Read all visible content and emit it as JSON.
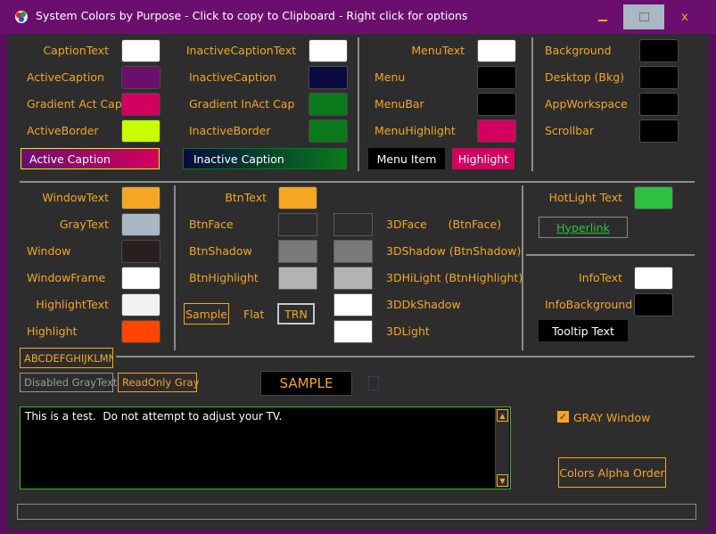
{
  "window": {
    "title": "System Colors by Purpose - Click to copy to Clipboard - Right click for options",
    "minimize": "_",
    "maximize": "□",
    "close": "x"
  },
  "caption_group": {
    "labels": [
      "CaptionText",
      "ActiveCaption",
      "Gradient Act Cap",
      "ActiveBorder"
    ],
    "colors": [
      "#ffffff",
      "#6b0f6e",
      "#d4005f",
      "#c8ff00"
    ],
    "sample": "Active Caption"
  },
  "inactive_group": {
    "labels": [
      "InactiveCaptionText",
      "InactiveCaption",
      "Gradient InAct Cap",
      "InactiveBorder"
    ],
    "colors": [
      "#ffffff",
      "#0a0a40",
      "#0a7a1a",
      "#0a7a1a"
    ],
    "sample": "Inactive Caption"
  },
  "menu_group": {
    "labels": [
      "MenuText",
      "Menu",
      "MenuBar",
      "MenuHighlight"
    ],
    "colors": [
      "#ffffff",
      "#000000",
      "#000000",
      "#d4005f"
    ],
    "menu_item": "Menu Item",
    "highlight": "Highlight"
  },
  "desktop_group": {
    "labels": [
      "Background",
      "Desktop (Bkg)",
      "AppWorkspace",
      "Scrollbar"
    ],
    "colors": [
      "#000000",
      "#000000",
      "#000000",
      "#000000"
    ]
  },
  "window_group": {
    "labels": [
      "WindowText",
      "GrayText",
      "Window",
      "WindowFrame",
      "HighlightText",
      "Highlight"
    ],
    "colors": [
      "#f5a623",
      "#a9b8c2",
      "#2a1f1f",
      "#ffffff",
      "#f2f2f2",
      "#ff4500"
    ]
  },
  "button_group": {
    "btntext_label": "BtnText",
    "btntext_color": "#f5a623",
    "left_labels": [
      "BtnFace",
      "BtnShadow",
      "BtnHighlight"
    ],
    "col1_colors": [
      "#2d2d2d",
      "#7a7a7a",
      "#b4b4b4"
    ],
    "col2_colors": [
      "#2d2d2d",
      "#7a7a7a",
      "#b4b4b4",
      "#ffffff",
      "#ffffff"
    ],
    "right_labels": [
      "3DFace      (BtnFace)",
      "3DShadow (BtnShadow)",
      "3DHiLight (BtnHighlight)",
      "3DDkShadow",
      "3DLight"
    ],
    "sample": "Sample",
    "flat": "Flat",
    "trn": "TRN"
  },
  "hotlight_group": {
    "hotlight_label": "HotLight Text",
    "hotlight_color": "#2ec040",
    "hyperlink": "Hyperlink",
    "infotext_label": "InfoText",
    "infotext_color": "#ffffff",
    "infobg_label": "InfoBackground",
    "infobg_color": "#000000",
    "tooltip": "Tooltip Text"
  },
  "misc": {
    "font_sample": "ABCDEFGHIJKLMNOPQRSTUVWXYZ",
    "disabled": "Disabled GrayText",
    "readonly": "ReadOnly Gray",
    "sample_banner": "SAMPLE",
    "textbox": "This is a test.  Do not attempt to adjust your TV.",
    "gray_window": "GRAY Window",
    "gray_window_checked": true,
    "alpha_button": "Colors Alpha Order"
  }
}
